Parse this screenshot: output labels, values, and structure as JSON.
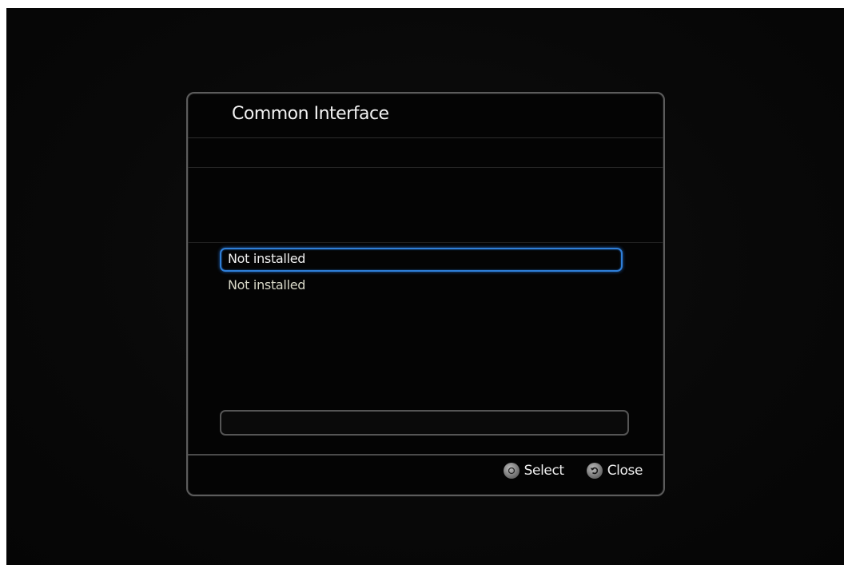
{
  "dialog": {
    "title": "Common Interface"
  },
  "slots": [
    {
      "label": "Not installed",
      "selected": true
    },
    {
      "label": "Not installed",
      "selected": false
    }
  ],
  "footer": {
    "select_label": "Select",
    "close_label": "Close",
    "select_icon": "ok-button-icon",
    "close_icon": "return-arrow-icon"
  },
  "colors": {
    "selection_outline": "#2f7fd8",
    "background": "#080808"
  }
}
